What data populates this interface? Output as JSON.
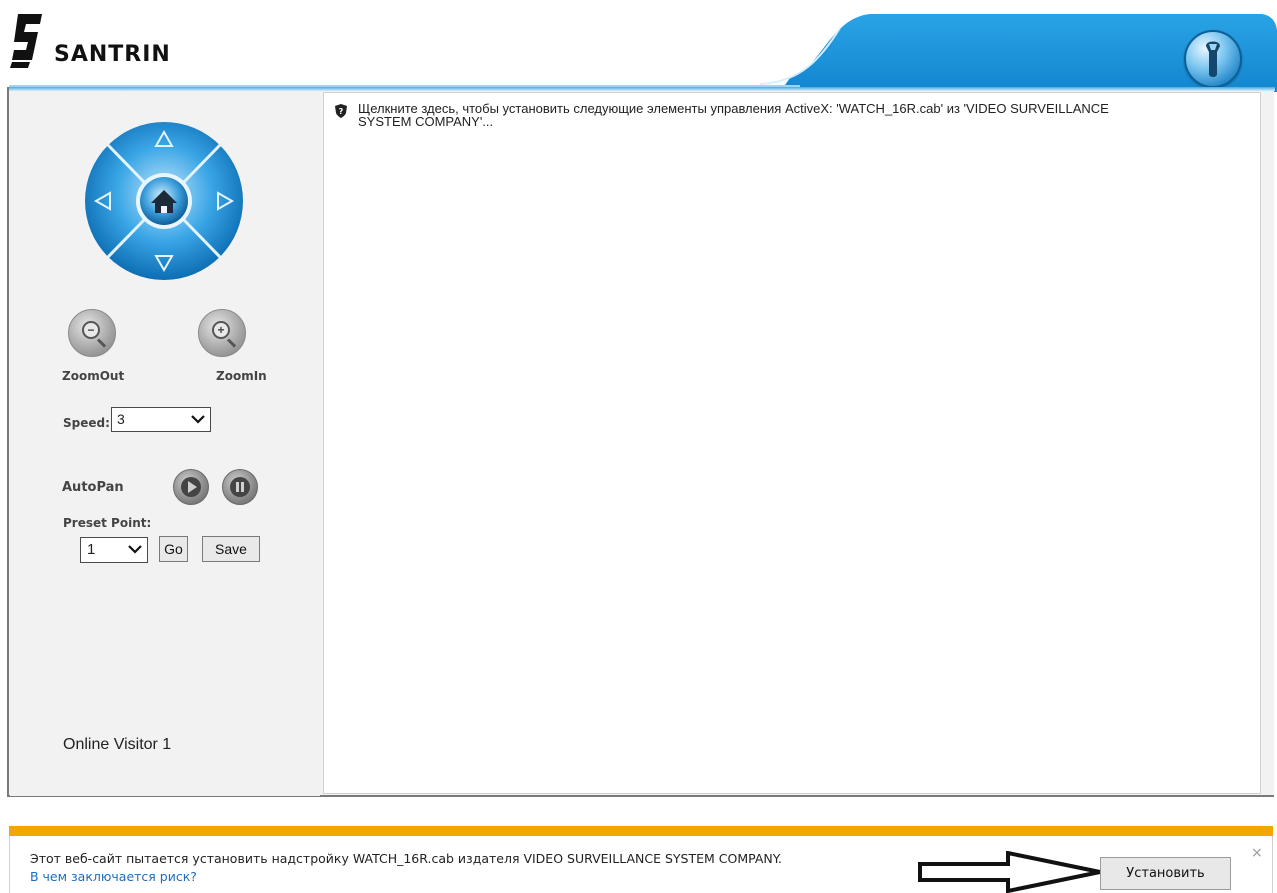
{
  "header": {
    "logo_text": "SANTRIN",
    "settings_icon": "wrench-icon",
    "accent_color": "#1e96d8"
  },
  "ptz": {
    "up_icon": "arrow-up-icon",
    "down_icon": "arrow-down-icon",
    "left_icon": "arrow-left-icon",
    "right_icon": "arrow-right-icon",
    "home_icon": "home-icon"
  },
  "zoom": {
    "out_label": "ZoomOut",
    "in_label": "ZoomIn"
  },
  "speed": {
    "label": "Speed:",
    "value": "3"
  },
  "autopan": {
    "label": "AutoPan",
    "play_icon": "play-icon",
    "stop_icon": "stop-icon"
  },
  "preset": {
    "label": "Preset Point:",
    "value": "1",
    "go_label": "Go",
    "save_label": "Save"
  },
  "visitor": {
    "text": "Online Visitor 1"
  },
  "main": {
    "activex_message_line1": "Щелкните здесь, чтобы установить следующие элементы управления ActiveX: 'WATCH_16R.cab' из 'VIDEO SURVEILLANCE",
    "activex_message_line2": "SYSTEM COMPANY'..."
  },
  "notification": {
    "message": "Этот веб-сайт пытается установить надстройку WATCH_16R.cab издателя VIDEO SURVEILLANCE SYSTEM COMPANY.",
    "risk_link": "В чем заключается риск?",
    "install_label": "Установить",
    "close_label": "×",
    "bar_color": "#f0a800"
  }
}
